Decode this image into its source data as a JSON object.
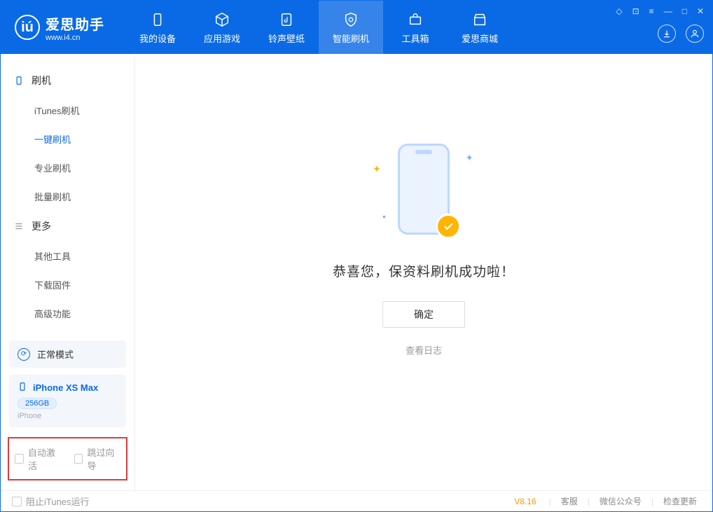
{
  "app": {
    "title": "爱思助手",
    "subtitle": "www.i4.cn"
  },
  "nav": {
    "device": "我的设备",
    "apps": "应用游戏",
    "ringtone": "铃声壁纸",
    "smart_flash": "智能刷机",
    "toolbox": "工具箱",
    "store": "爱思商城"
  },
  "sidebar": {
    "group_flash": "刷机",
    "items_flash": {
      "itunes": "iTunes刷机",
      "onekey": "一键刷机",
      "pro": "专业刷机",
      "batch": "批量刷机"
    },
    "group_more": "更多",
    "items_more": {
      "other": "其他工具",
      "firmware": "下载固件",
      "advanced": "高级功能"
    },
    "mode_label": "正常模式",
    "device_name": "iPhone XS Max",
    "device_storage": "256GB",
    "device_type": "iPhone",
    "ck_auto_activate": "自动激活",
    "ck_skip_guide": "跳过向导"
  },
  "main": {
    "success": "恭喜您，保资料刷机成功啦！",
    "ok": "确定",
    "view_log": "查看日志"
  },
  "footer": {
    "block_itunes": "阻止iTunes运行",
    "version": "V8.16",
    "support": "客服",
    "wechat": "微信公众号",
    "update": "检查更新"
  }
}
